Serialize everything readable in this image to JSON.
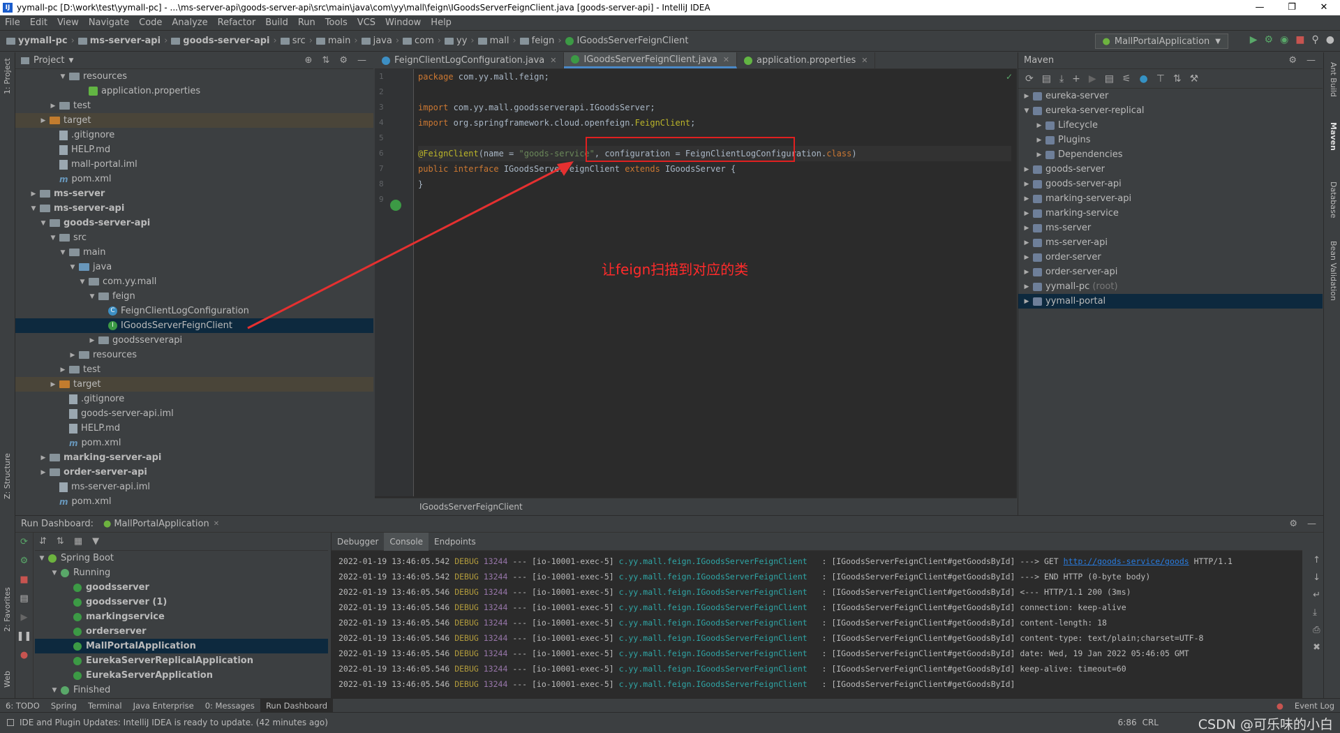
{
  "window": {
    "title": "yymall-pc [D:\\work\\test\\yymall-pc] - ...\\ms-server-api\\goods-server-api\\src\\main\\java\\com\\yy\\mall\\feign\\IGoodsServerFeignClient.java [goods-server-api] - IntelliJ IDEA",
    "app_icon": "IJ"
  },
  "menu": [
    "File",
    "Edit",
    "View",
    "Navigate",
    "Code",
    "Analyze",
    "Refactor",
    "Build",
    "Run",
    "Tools",
    "VCS",
    "Window",
    "Help"
  ],
  "breadcrumbs": [
    "yymall-pc",
    "ms-server-api",
    "goods-server-api",
    "src",
    "main",
    "java",
    "com",
    "yy",
    "mall",
    "feign",
    "IGoodsServerFeignClient"
  ],
  "run_config": "MallPortalApplication",
  "left_strip": {
    "project": "1: Project",
    "structure": "Z: Structure",
    "favorites": "2: Favorites",
    "web": "Web"
  },
  "right_strip": {
    "ant": "Ant Build",
    "maven": "Maven",
    "database": "Database",
    "bean": "Bean Validation"
  },
  "project_panel": {
    "title": "Project",
    "rows": [
      {
        "label": "resources",
        "indent": 4,
        "arrow": "▼",
        "icon": "folder"
      },
      {
        "label": "application.properties",
        "indent": 6,
        "arrow": "",
        "icon": "leaf"
      },
      {
        "label": "test",
        "indent": 3,
        "arrow": "▶",
        "icon": "folder"
      },
      {
        "label": "target",
        "indent": 2,
        "arrow": "▶",
        "icon": "folder-orange",
        "hl": true
      },
      {
        "label": ".gitignore",
        "indent": 3,
        "arrow": "",
        "icon": "file"
      },
      {
        "label": "HELP.md",
        "indent": 3,
        "arrow": "",
        "icon": "file"
      },
      {
        "label": "mall-portal.iml",
        "indent": 3,
        "arrow": "",
        "icon": "file"
      },
      {
        "label": "pom.xml",
        "indent": 3,
        "arrow": "",
        "icon": "maven"
      },
      {
        "label": "ms-server",
        "indent": 1,
        "arrow": "▶",
        "icon": "folder",
        "bold": true
      },
      {
        "label": "ms-server-api",
        "indent": 1,
        "arrow": "▼",
        "icon": "folder",
        "bold": true
      },
      {
        "label": "goods-server-api",
        "indent": 2,
        "arrow": "▼",
        "icon": "folder",
        "bold": true
      },
      {
        "label": "src",
        "indent": 3,
        "arrow": "▼",
        "icon": "folder"
      },
      {
        "label": "main",
        "indent": 4,
        "arrow": "▼",
        "icon": "folder"
      },
      {
        "label": "java",
        "indent": 5,
        "arrow": "▼",
        "icon": "folder-blue"
      },
      {
        "label": "com.yy.mall",
        "indent": 6,
        "arrow": "▼",
        "icon": "folder"
      },
      {
        "label": "feign",
        "indent": 7,
        "arrow": "▼",
        "icon": "folder"
      },
      {
        "label": "FeignClientLogConfiguration",
        "indent": 8,
        "arrow": "",
        "icon": "class"
      },
      {
        "label": "IGoodsServerFeignClient",
        "indent": 8,
        "arrow": "",
        "icon": "class-green",
        "sel": true
      },
      {
        "label": "goodsserverapi",
        "indent": 7,
        "arrow": "▶",
        "icon": "folder"
      },
      {
        "label": "resources",
        "indent": 5,
        "arrow": "▶",
        "icon": "folder"
      },
      {
        "label": "test",
        "indent": 4,
        "arrow": "▶",
        "icon": "folder"
      },
      {
        "label": "target",
        "indent": 3,
        "arrow": "▶",
        "icon": "folder-orange",
        "hl": true
      },
      {
        "label": ".gitignore",
        "indent": 4,
        "arrow": "",
        "icon": "file"
      },
      {
        "label": "goods-server-api.iml",
        "indent": 4,
        "arrow": "",
        "icon": "file"
      },
      {
        "label": "HELP.md",
        "indent": 4,
        "arrow": "",
        "icon": "file"
      },
      {
        "label": "pom.xml",
        "indent": 4,
        "arrow": "",
        "icon": "maven"
      },
      {
        "label": "marking-server-api",
        "indent": 2,
        "arrow": "▶",
        "icon": "folder",
        "bold": true
      },
      {
        "label": "order-server-api",
        "indent": 2,
        "arrow": "▶",
        "icon": "folder",
        "bold": true
      },
      {
        "label": "ms-server-api.iml",
        "indent": 3,
        "arrow": "",
        "icon": "file"
      },
      {
        "label": "pom.xml",
        "indent": 3,
        "arrow": "",
        "icon": "maven"
      }
    ]
  },
  "editor": {
    "tabs": [
      {
        "label": "FeignClientLogConfiguration.java",
        "active": false
      },
      {
        "label": "IGoodsServerFeignClient.java",
        "active": true
      },
      {
        "label": "application.properties",
        "active": false
      }
    ],
    "lines": [
      [
        {
          "t": "package",
          "c": "kw"
        },
        {
          "t": " com.yy.mall.feign;",
          "c": ""
        }
      ],
      [],
      [
        {
          "t": "import",
          "c": "kw"
        },
        {
          "t": " com.yy.mall.goodsserverapi.IGoodsServer;",
          "c": ""
        }
      ],
      [
        {
          "t": "import",
          "c": "kw"
        },
        {
          "t": " org.springframework.cloud.openfeign.",
          "c": ""
        },
        {
          "t": "FeignClient",
          "c": "an"
        },
        {
          "t": ";",
          "c": ""
        }
      ],
      [],
      [
        {
          "t": "@FeignClient",
          "c": "an"
        },
        {
          "t": "(name = ",
          "c": ""
        },
        {
          "t": "\"goods-service\"",
          "c": "st"
        },
        {
          "t": ", configuration = FeignClientLogConfiguration.",
          "c": ""
        },
        {
          "t": "class",
          "c": "kw"
        },
        {
          "t": ")",
          "c": ""
        }
      ],
      [
        {
          "t": "public interface",
          "c": "kw"
        },
        {
          "t": " IGoodsServerFeignClient ",
          "c": ""
        },
        {
          "t": "extends",
          "c": "kw"
        },
        {
          "t": " IGoodsServer {",
          "c": ""
        }
      ],
      [
        {
          "t": "}",
          "c": ""
        }
      ],
      []
    ],
    "breadcrumb": "IGoodsServerFeignClient",
    "annotation": "让feign扫描到对应的类"
  },
  "maven": {
    "title": "Maven",
    "rows": [
      {
        "label": "eureka-server",
        "indent": 0,
        "arrow": "▶"
      },
      {
        "label": "eureka-server-replical",
        "indent": 0,
        "arrow": "▼"
      },
      {
        "label": "Lifecycle",
        "indent": 1,
        "arrow": "▶"
      },
      {
        "label": "Plugins",
        "indent": 1,
        "arrow": "▶"
      },
      {
        "label": "Dependencies",
        "indent": 1,
        "arrow": "▶"
      },
      {
        "label": "goods-server",
        "indent": 0,
        "arrow": "▶"
      },
      {
        "label": "goods-server-api",
        "indent": 0,
        "arrow": "▶"
      },
      {
        "label": "marking-server-api",
        "indent": 0,
        "arrow": "▶"
      },
      {
        "label": "marking-service",
        "indent": 0,
        "arrow": "▶"
      },
      {
        "label": "ms-server",
        "indent": 0,
        "arrow": "▶"
      },
      {
        "label": "ms-server-api",
        "indent": 0,
        "arrow": "▶"
      },
      {
        "label": "order-server",
        "indent": 0,
        "arrow": "▶"
      },
      {
        "label": "order-server-api",
        "indent": 0,
        "arrow": "▶"
      },
      {
        "label": "yymall-pc",
        "indent": 0,
        "arrow": "▶",
        "suffix": "(root)"
      },
      {
        "label": "yymall-portal",
        "indent": 0,
        "arrow": "▶",
        "sel": true
      }
    ]
  },
  "run_dashboard": {
    "title": "Run Dashboard:",
    "tab": "MallPortalApplication",
    "rows": [
      {
        "label": "Spring Boot",
        "indent": 0,
        "arrow": "▼",
        "bold": false
      },
      {
        "label": "Running",
        "indent": 1,
        "arrow": "▼",
        "bold": false
      },
      {
        "label": "goodsserver",
        "indent": 2,
        "arrow": "",
        "bold": true
      },
      {
        "label": "goodsserver (1)",
        "indent": 2,
        "arrow": "",
        "bold": true
      },
      {
        "label": "markingservice",
        "indent": 2,
        "arrow": "",
        "bold": true
      },
      {
        "label": "orderserver",
        "indent": 2,
        "arrow": "",
        "bold": true
      },
      {
        "label": "MallPortalApplication",
        "indent": 2,
        "arrow": "",
        "bold": true,
        "sel": true
      },
      {
        "label": "EurekaServerReplicalApplication",
        "indent": 2,
        "arrow": "",
        "bold": true
      },
      {
        "label": "EurekaServerApplication",
        "indent": 2,
        "arrow": "",
        "bold": true
      },
      {
        "label": "Finished",
        "indent": 1,
        "arrow": "▼",
        "bold": false
      }
    ]
  },
  "console": {
    "tabs": [
      "Debugger",
      "Console",
      "Endpoints"
    ],
    "logs": [
      {
        "ts": "2022-01-19 13:46:05.542",
        "lvl": "DEBUG",
        "pid": "13244",
        "th": "--- [io-10001-exec-5]",
        "lg": "c.yy.mall.feign.IGoodsServerFeignClient",
        "pre": "  : [IGoodsServerFeignClient#getGoodsById] ---> GET ",
        "url": "http://goods-service/goods",
        "post": " HTTP/1.1"
      },
      {
        "ts": "2022-01-19 13:46:05.542",
        "lvl": "DEBUG",
        "pid": "13244",
        "th": "--- [io-10001-exec-5]",
        "lg": "c.yy.mall.feign.IGoodsServerFeignClient",
        "pre": "  : [IGoodsServerFeignClient#getGoodsById] ---> END HTTP (0-byte body)",
        "url": "",
        "post": ""
      },
      {
        "ts": "2022-01-19 13:46:05.546",
        "lvl": "DEBUG",
        "pid": "13244",
        "th": "--- [io-10001-exec-5]",
        "lg": "c.yy.mall.feign.IGoodsServerFeignClient",
        "pre": "  : [IGoodsServerFeignClient#getGoodsById] <--- HTTP/1.1 200 (3ms)",
        "url": "",
        "post": ""
      },
      {
        "ts": "2022-01-19 13:46:05.546",
        "lvl": "DEBUG",
        "pid": "13244",
        "th": "--- [io-10001-exec-5]",
        "lg": "c.yy.mall.feign.IGoodsServerFeignClient",
        "pre": "  : [IGoodsServerFeignClient#getGoodsById] connection: keep-alive",
        "url": "",
        "post": ""
      },
      {
        "ts": "2022-01-19 13:46:05.546",
        "lvl": "DEBUG",
        "pid": "13244",
        "th": "--- [io-10001-exec-5]",
        "lg": "c.yy.mall.feign.IGoodsServerFeignClient",
        "pre": "  : [IGoodsServerFeignClient#getGoodsById] content-length: 18",
        "url": "",
        "post": ""
      },
      {
        "ts": "2022-01-19 13:46:05.546",
        "lvl": "DEBUG",
        "pid": "13244",
        "th": "--- [io-10001-exec-5]",
        "lg": "c.yy.mall.feign.IGoodsServerFeignClient",
        "pre": "  : [IGoodsServerFeignClient#getGoodsById] content-type: text/plain;charset=UTF-8",
        "url": "",
        "post": ""
      },
      {
        "ts": "2022-01-19 13:46:05.546",
        "lvl": "DEBUG",
        "pid": "13244",
        "th": "--- [io-10001-exec-5]",
        "lg": "c.yy.mall.feign.IGoodsServerFeignClient",
        "pre": "  : [IGoodsServerFeignClient#getGoodsById] date: Wed, 19 Jan 2022 05:46:05 GMT",
        "url": "",
        "post": ""
      },
      {
        "ts": "2022-01-19 13:46:05.546",
        "lvl": "DEBUG",
        "pid": "13244",
        "th": "--- [io-10001-exec-5]",
        "lg": "c.yy.mall.feign.IGoodsServerFeignClient",
        "pre": "  : [IGoodsServerFeignClient#getGoodsById] keep-alive: timeout=60",
        "url": "",
        "post": ""
      },
      {
        "ts": "2022-01-19 13:46:05.546",
        "lvl": "DEBUG",
        "pid": "13244",
        "th": "--- [io-10001-exec-5]",
        "lg": "c.yy.mall.feign.IGoodsServerFeignClient",
        "pre": "  : [IGoodsServerFeignClient#getGoodsById]",
        "url": "",
        "post": ""
      }
    ]
  },
  "tool_windows": [
    "6: TODO",
    "Spring",
    "Terminal",
    "Java Enterprise",
    "0: Messages",
    "Run Dashboard"
  ],
  "event_log": "Event Log",
  "status": {
    "message": "IDE and Plugin Updates: IntelliJ IDEA is ready to update. (42 minutes ago)",
    "position": "6:86",
    "encoding": "CRL"
  },
  "watermark": "CSDN @可乐味的小白"
}
